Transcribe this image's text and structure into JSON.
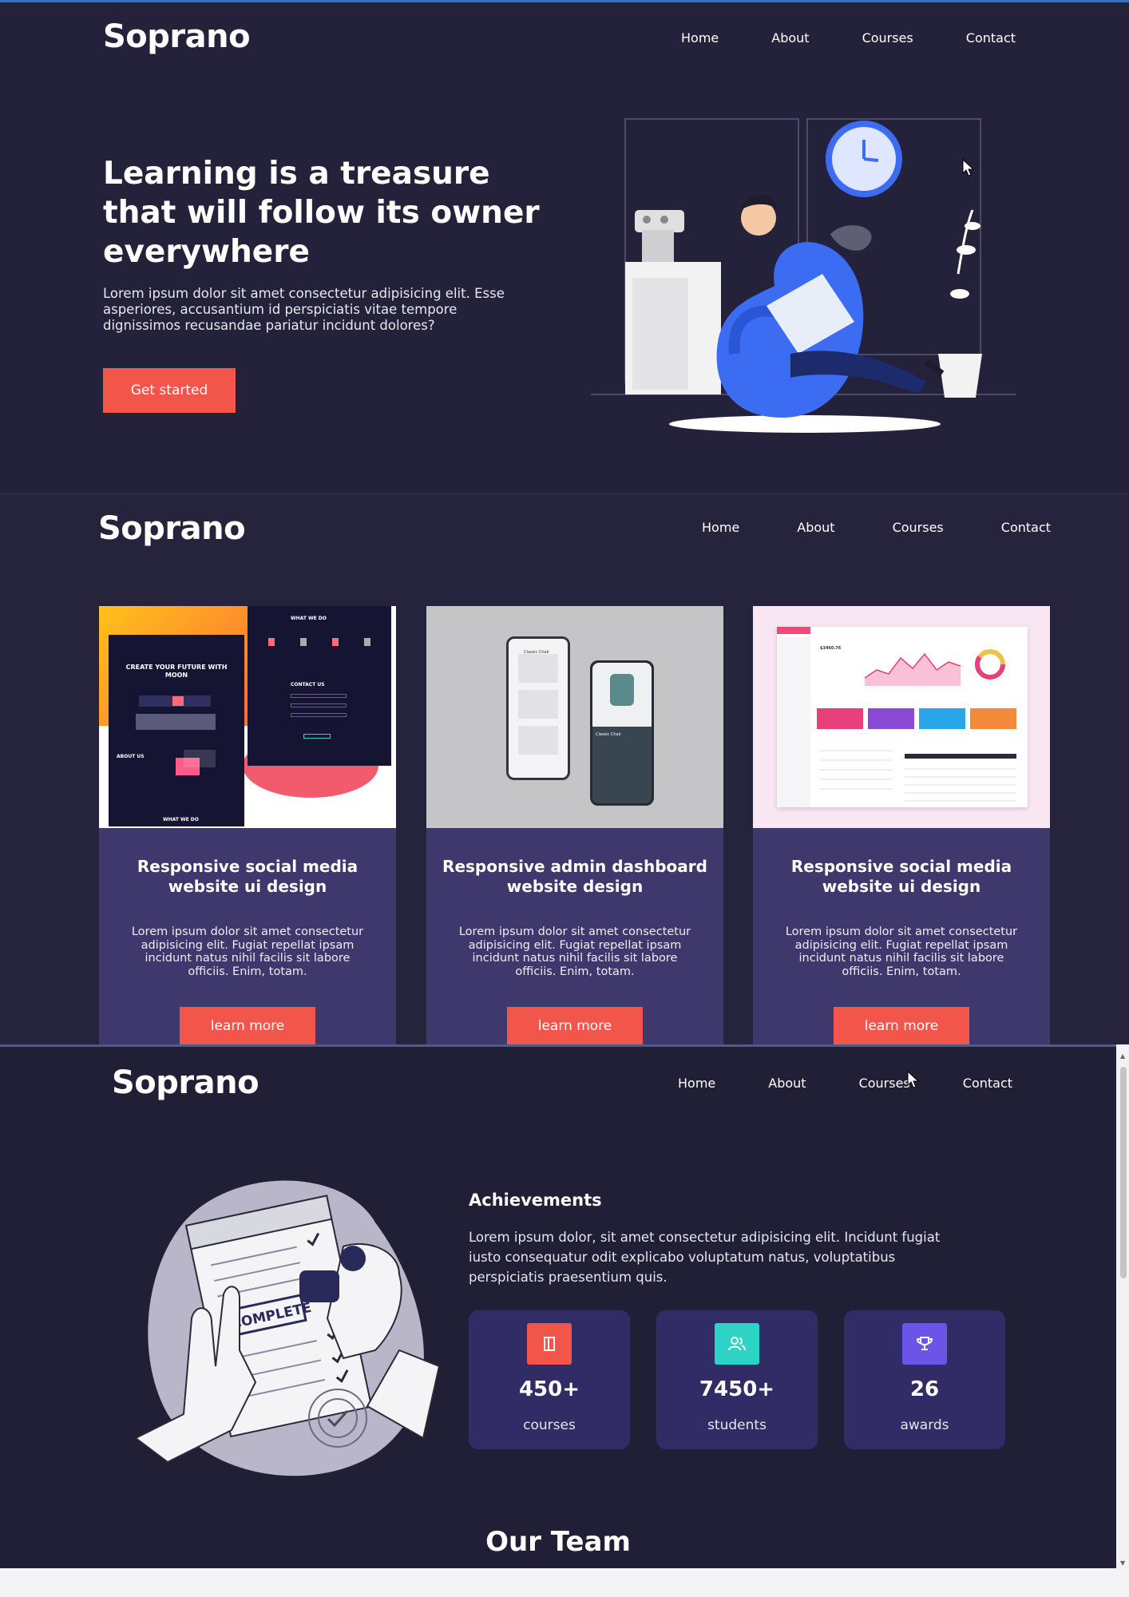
{
  "section1": {
    "brand": "Soprano",
    "nav": [
      "Home",
      "About",
      "Courses",
      "Contact"
    ],
    "hero_title": "Learning is a treasure that will follow its owner everywhere",
    "hero_text": "Lorem ipsum dolor sit amet consectetur adipisicing elit. Esse asperiores, accusantium id perspiciatis vitae tempore dignissimos recusandae pariatur incidunt dolores?",
    "cta": "Get started"
  },
  "section2": {
    "brand": "Soprano",
    "nav": [
      "Home",
      "About",
      "Courses",
      "Contact"
    ],
    "cards": [
      {
        "title": "Responsive social media website ui design",
        "text": "Lorem ipsum dolor sit amet consectetur adipisicing elit. Fugiat repellat ipsam incidunt natus nihil facilis sit labore officiis. Enim, totam.",
        "button": "learn more",
        "mock_headline": "CREATE YOUR FUTURE WITH MOON",
        "mock_what": "WHAT WE DO",
        "mock_contact": "CONTACT US",
        "mock_about": "ABOUT US"
      },
      {
        "title": "Responsive admin dashboard website design",
        "text": "Lorem ipsum dolor sit amet consectetur adipisicing elit. Fugiat repellat ipsam incidunt natus nihil facilis sit labore officiis. Enim, totam.",
        "button": "learn more",
        "mock_item": "Classic Chair"
      },
      {
        "title": "Responsive social media website ui design",
        "text": "Lorem ipsum dolor sit amet consectetur adipisicing elit. Fugiat repellat ipsam incidunt natus nihil facilis sit labore officiis. Enim, totam.",
        "button": "learn more",
        "mock_value": "$3460.76"
      }
    ]
  },
  "section3": {
    "brand": "Soprano",
    "nav": [
      "Home",
      "About",
      "Courses",
      "Contact"
    ],
    "stamp_text": "COMPLETE",
    "achievements_title": "Achievements",
    "achievements_text": "Lorem ipsum dolor, sit amet consectetur adipisicing elit. Incidunt fugiat iusto consequatur odit explicabo voluptatum natus, voluptatibus perspiciatis praesentium quis.",
    "stats": [
      {
        "value": "450+",
        "label": "courses",
        "icon": "book-icon",
        "color": "#f2554a"
      },
      {
        "value": "7450+",
        "label": "students",
        "icon": "users-icon",
        "color": "#2dd4c6"
      },
      {
        "value": "26",
        "label": "awards",
        "icon": "trophy-icon",
        "color": "#6d54e8"
      }
    ],
    "team_title": "Our Team"
  },
  "colors": {
    "background": "#23223a",
    "accent": "#f2554a",
    "card": "#3e386c",
    "stat_card": "#322c66",
    "illustration_blue": "#3b6cf2"
  }
}
